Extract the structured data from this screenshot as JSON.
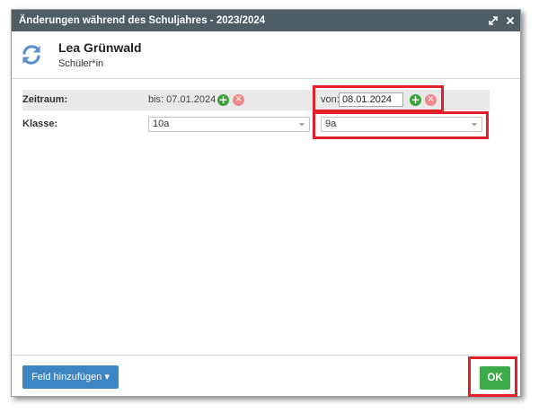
{
  "dialog": {
    "title": "Änderungen während des Schuljahres - 2023/2024",
    "expand_icon": "expand-icon",
    "close_icon": "close-icon"
  },
  "header": {
    "icon": "reload-icon",
    "name": "Lea Grünwald",
    "role": "Schüler*in"
  },
  "rows": {
    "zeitraum": {
      "label": "Zeitraum:",
      "bis_text": "bis: 07.01.2024",
      "von_label": "von:",
      "von_value": "08.01.2024"
    },
    "klasse": {
      "label": "Klasse:",
      "old_value": "10a",
      "new_value": "9a"
    }
  },
  "footer": {
    "add_field_label": "Feld hinzufügen ▾",
    "ok_label": "OK"
  },
  "colors": {
    "titlebar": "#4f5e64",
    "highlight": "#e3202a",
    "ok_button": "#3eab4b",
    "feld_button": "#3c86c6"
  }
}
